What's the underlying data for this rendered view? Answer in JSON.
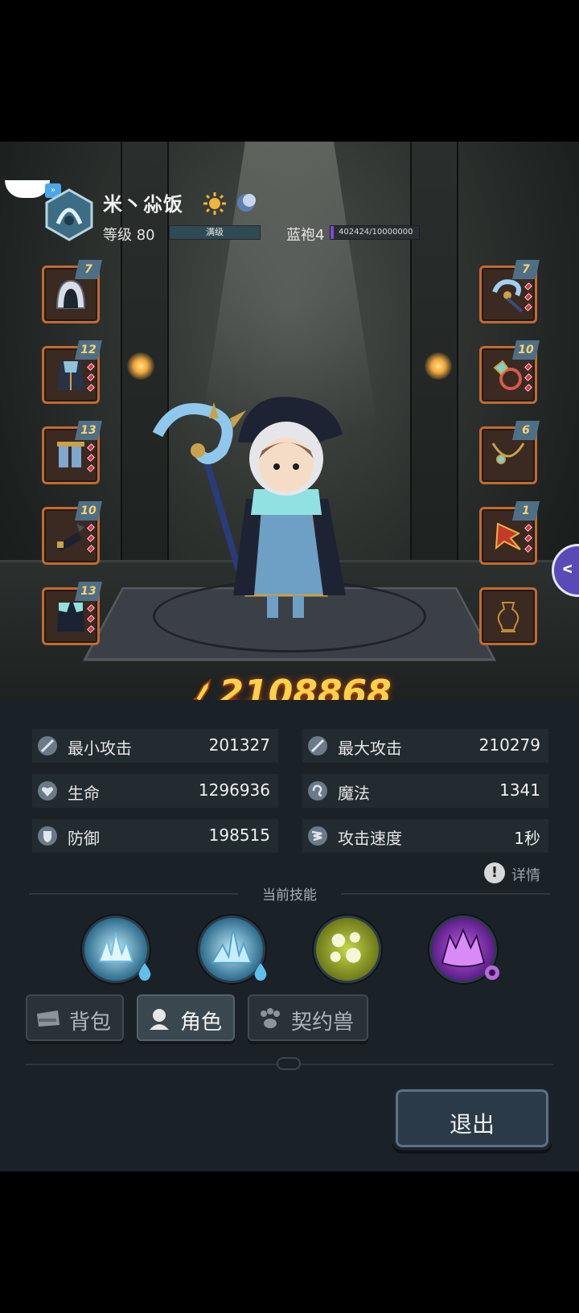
{
  "header": {
    "player_name": "米丶尛饭",
    "level_label": "等级 80",
    "level_bar_text": "满级",
    "level_progress": 1.0,
    "rank_label": "蓝袍4",
    "exp_text": "402424/10000000",
    "exp_progress": 0.04
  },
  "equipment": {
    "left": [
      {
        "slot": "hood",
        "level": "7"
      },
      {
        "slot": "robe",
        "level": "12"
      },
      {
        "slot": "boots",
        "level": "13"
      },
      {
        "slot": "bracer",
        "level": "10"
      },
      {
        "slot": "cape",
        "level": "13"
      }
    ],
    "right": [
      {
        "slot": "staff",
        "level": "7"
      },
      {
        "slot": "ring",
        "level": "10"
      },
      {
        "slot": "necklace",
        "level": "6"
      },
      {
        "slot": "charm",
        "level": "1"
      },
      {
        "slot": "empty-vase",
        "level": ""
      }
    ]
  },
  "power": "2108868",
  "stats": {
    "min_attack": {
      "label": "最小攻击",
      "value": "201327"
    },
    "max_attack": {
      "label": "最大攻击",
      "value": "210279"
    },
    "health": {
      "label": "生命",
      "value": "1296936"
    },
    "mana": {
      "label": "魔法",
      "value": "1341"
    },
    "defense": {
      "label": "防御",
      "value": "198515"
    },
    "attack_speed": {
      "label": "攻击速度",
      "value": "1秒"
    }
  },
  "details_label": "详情",
  "skills_title": "当前技能",
  "skills": [
    {
      "name": "ice-crystal-skill-icon",
      "color": "#5fb6d8"
    },
    {
      "name": "ice-spike-skill-icon",
      "color": "#4aa2cf"
    },
    {
      "name": "poison-orbs-skill-icon",
      "color": "#a4b52a"
    },
    {
      "name": "shadow-beast-skill-icon",
      "color": "#8a3fb8"
    }
  ],
  "tabs": [
    {
      "label": "背包",
      "icon": "backpack-icon"
    },
    {
      "label": "角色",
      "icon": "character-icon"
    },
    {
      "label": "契约兽",
      "icon": "paw-icon"
    }
  ],
  "vip_label": "V",
  "exit_label": "退出",
  "colors": {
    "slot_border": "#c36a2e",
    "power_gold": "#ffd24a",
    "exp_purple": "#7d4ad8",
    "panel_bg": "#1b2227"
  }
}
